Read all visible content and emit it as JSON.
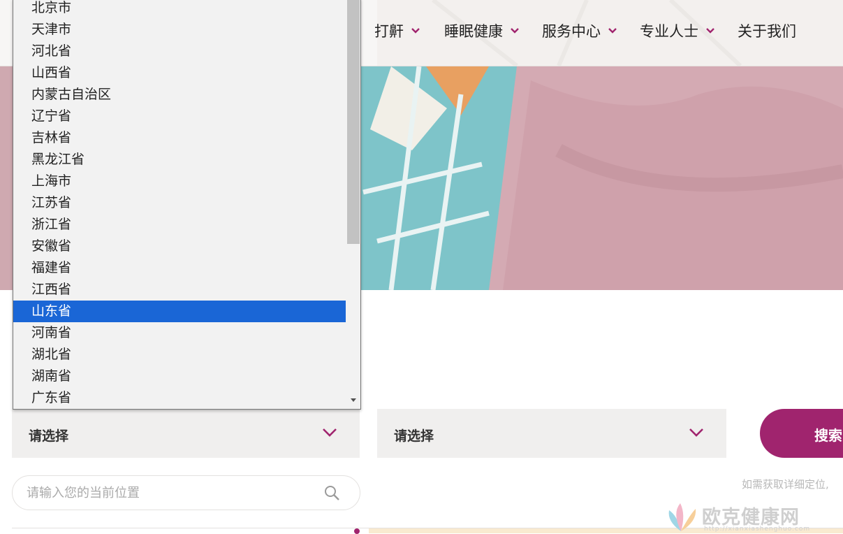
{
  "nav": {
    "items": [
      {
        "label": "打鼾"
      },
      {
        "label": "睡眠健康"
      },
      {
        "label": "服务中心"
      },
      {
        "label": "专业人士"
      },
      {
        "label": "关于我们"
      }
    ]
  },
  "dropdown": {
    "options": [
      "北京市",
      "天津市",
      "河北省",
      "山西省",
      "内蒙古自治区",
      "辽宁省",
      "吉林省",
      "黑龙江省",
      "上海市",
      "江苏省",
      "浙江省",
      "安徽省",
      "福建省",
      "江西省",
      "山东省",
      "河南省",
      "湖北省",
      "湖南省",
      "广东省"
    ],
    "selected": "山东省"
  },
  "filters": {
    "province_select": "请选择",
    "city_select": "请选择",
    "search_button": "搜索"
  },
  "location": {
    "placeholder": "请输入您的当前位置",
    "hint": "如需获取详细定位,"
  },
  "watermark": {
    "name": "欧克健康网",
    "url": "http://xianxiashenghuo.com"
  },
  "colors": {
    "accent": "#a0246e",
    "selection": "#1a66d6"
  }
}
